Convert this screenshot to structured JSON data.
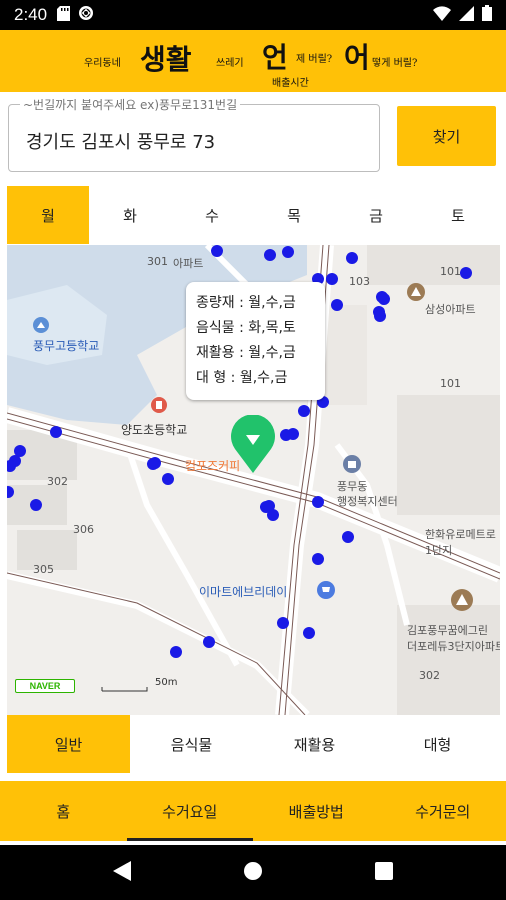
{
  "status_bar": {
    "time": "2:40"
  },
  "header": {
    "parts": [
      {
        "text": "우리동네",
        "size": "small"
      },
      {
        "text": "생활",
        "size": "big"
      },
      {
        "text": "쓰레기",
        "size": "small"
      },
      {
        "text": "언",
        "size": "big"
      },
      {
        "text": "제 버릴?",
        "size": "small"
      },
      {
        "text": "어",
        "size": "big"
      },
      {
        "text": "떻게 버릴?",
        "size": "small"
      },
      {
        "text": "배출시간",
        "size": "small"
      }
    ]
  },
  "search": {
    "legend": "~번길까지 붙여주세요 ex)풍무로131번길",
    "value": "경기도 김포시 풍무로 73",
    "button_label": "찾기"
  },
  "day_tabs": [
    {
      "label": "월",
      "active": true
    },
    {
      "label": "화",
      "active": false
    },
    {
      "label": "수",
      "active": false
    },
    {
      "label": "목",
      "active": false
    },
    {
      "label": "금",
      "active": false
    },
    {
      "label": "토",
      "active": false
    }
  ],
  "map": {
    "info_bubble": [
      "종량재 : 월,수,금",
      "음식물 : 화,목,토",
      "재활용 : 월,수,금",
      "대 형 : 월,수,금"
    ],
    "labels": {
      "school1": "풍무고등학교",
      "school2": "양도초등학교",
      "cafe": "컴포즈커피",
      "center": "풍무동\n행정복지센터",
      "mart": "이마트에브리데이",
      "apt1": "삼성아파트",
      "apt2": "김포풍무꿈에그린\n더포레듀3단지아파트",
      "road": "한화유로메트로\n1단지",
      "n101a": "101",
      "n101b": "101",
      "n302": "302",
      "n306": "306",
      "n305": "305",
      "n302b": "302",
      "n103": "103",
      "n301": "301",
      "apt_small": "아파트",
      "scale": "50m"
    },
    "brand": "NAVER",
    "pin_color": "#21c26b",
    "marker_color": "#1a1ae6"
  },
  "type_tabs": [
    {
      "label": "일반",
      "active": true
    },
    {
      "label": "음식물",
      "active": false
    },
    {
      "label": "재활용",
      "active": false
    },
    {
      "label": "대형",
      "active": false
    }
  ],
  "bottom_nav": [
    {
      "label": "홈",
      "active": false
    },
    {
      "label": "수거요일",
      "active": true
    },
    {
      "label": "배출방법",
      "active": false
    },
    {
      "label": "수거문의",
      "active": false
    }
  ],
  "colors": {
    "accent": "#ffc107"
  }
}
